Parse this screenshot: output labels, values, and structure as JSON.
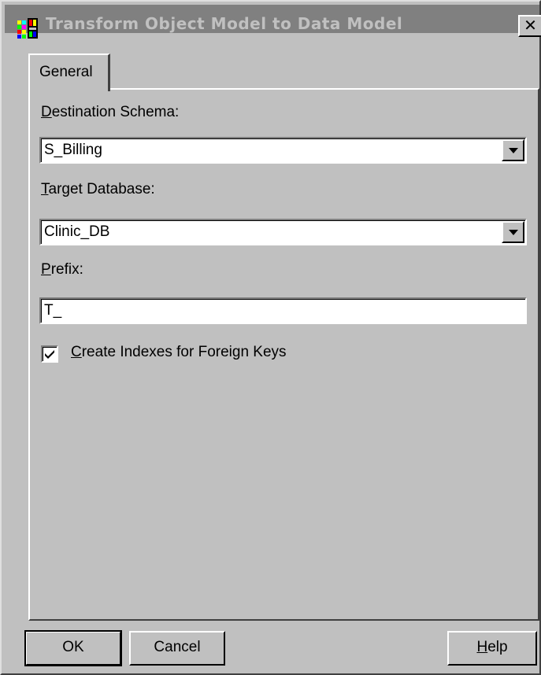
{
  "window": {
    "title": "Transform Object Model to Data Model",
    "close_label": "✕",
    "icon": "app-icon"
  },
  "tabs": [
    {
      "label": "General",
      "selected": true
    }
  ],
  "form": {
    "destination_schema": {
      "label_prefix": "",
      "label_mnemonic": "D",
      "label_rest": "estination Schema:",
      "value": "S_Billing"
    },
    "target_database": {
      "label_mnemonic": "T",
      "label_rest": "arget Database:",
      "value": "Clinic_DB"
    },
    "prefix": {
      "label_mnemonic": "P",
      "label_rest": "refix:",
      "value": "T_"
    },
    "create_indexes": {
      "label_mnemonic": "C",
      "label_rest": "reate Indexes for Foreign Keys",
      "checked": true
    }
  },
  "buttons": {
    "ok": "OK",
    "cancel": "Cancel",
    "help_mnemonic": "H",
    "help_rest": "elp"
  }
}
